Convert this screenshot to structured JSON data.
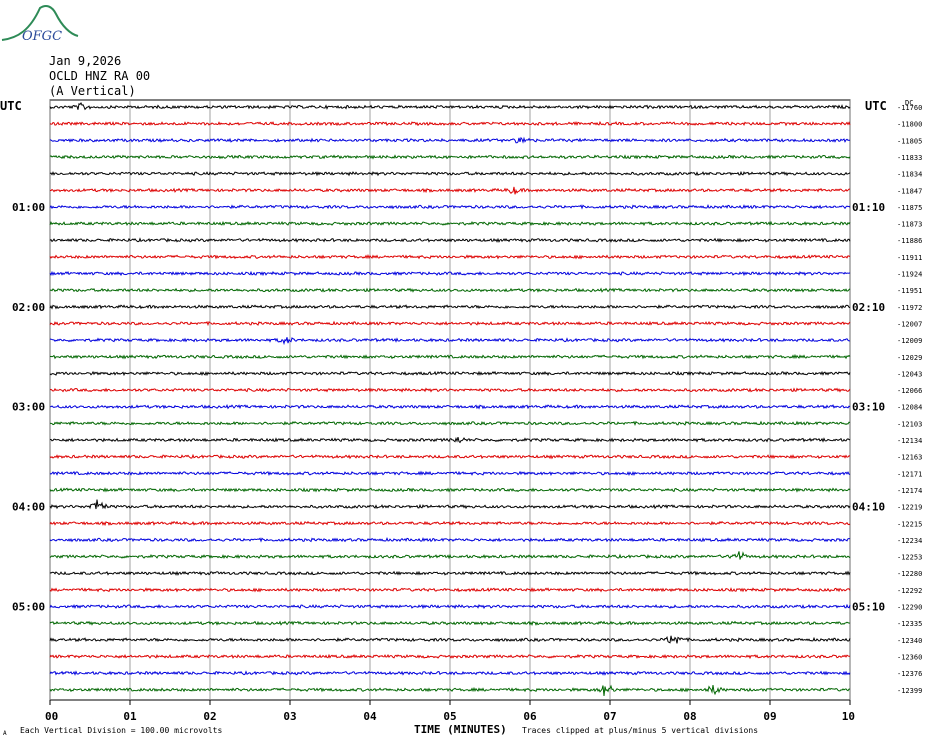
{
  "logo": {
    "text": "OFGC",
    "icon": "volcano-logo-icon"
  },
  "header": {
    "date": "Jan 9,2026",
    "station": "OCLD HNZ RA 00",
    "component": "(A Vertical)"
  },
  "axes": {
    "left_tz": "UTC",
    "right_tz": "UTC",
    "dc_label": "DC",
    "xlabel": "TIME (MINUTES)",
    "scale_note": "Each Vertical Division =  100.00 microvolts",
    "clip_note": "Traces clipped at plus/minus 5 vertical divisions",
    "corner_mark": "A"
  },
  "chart_data": {
    "type": "line",
    "x_ticks": [
      "00",
      "01",
      "02",
      "03",
      "04",
      "05",
      "06",
      "07",
      "08",
      "09",
      "10"
    ],
    "xlim": [
      0,
      10
    ],
    "left_time_labels": [
      {
        "row": 6,
        "text": "01:00"
      },
      {
        "row": 12,
        "text": "02:00"
      },
      {
        "row": 18,
        "text": "03:00"
      },
      {
        "row": 24,
        "text": "04:00"
      },
      {
        "row": 30,
        "text": "05:00"
      }
    ],
    "right_time_labels": [
      {
        "row": 6,
        "text": "01:10"
      },
      {
        "row": 12,
        "text": "02:10"
      },
      {
        "row": 18,
        "text": "03:10"
      },
      {
        "row": 24,
        "text": "04:10"
      },
      {
        "row": 30,
        "text": "05:10"
      }
    ],
    "colors": [
      "#000000",
      "#dd0000",
      "#0000dd",
      "#006600"
    ],
    "dc_offsets": [
      -11760,
      -11800,
      -11805,
      -11833,
      -11834,
      -11847,
      -11875,
      -11873,
      -11886,
      -11911,
      -11924,
      -11951,
      -11972,
      -12007,
      -12009,
      -12029,
      -12043,
      -12066,
      -12084,
      -12103,
      -12134,
      -12163,
      -12171,
      -12174,
      -12219,
      -12215,
      -12234,
      -12253,
      -12280,
      -12292,
      -12290,
      -12335,
      -12340,
      -12360,
      -12376,
      -12399
    ],
    "events": [
      {
        "row": 0,
        "minute": 0.4,
        "amp": 3
      },
      {
        "row": 2,
        "minute": 5.9,
        "amp": 3
      },
      {
        "row": 5,
        "minute": 5.8,
        "amp": 3
      },
      {
        "row": 14,
        "minute": 2.95,
        "amp": 3
      },
      {
        "row": 20,
        "minute": 5.1,
        "amp": 2.5
      },
      {
        "row": 24,
        "minute": 0.6,
        "amp": 7
      },
      {
        "row": 27,
        "minute": 8.6,
        "amp": 5
      },
      {
        "row": 32,
        "minute": 7.8,
        "amp": 6
      },
      {
        "row": 35,
        "minute": 6.95,
        "amp": 6
      },
      {
        "row": 35,
        "minute": 8.3,
        "amp": 4
      }
    ]
  }
}
